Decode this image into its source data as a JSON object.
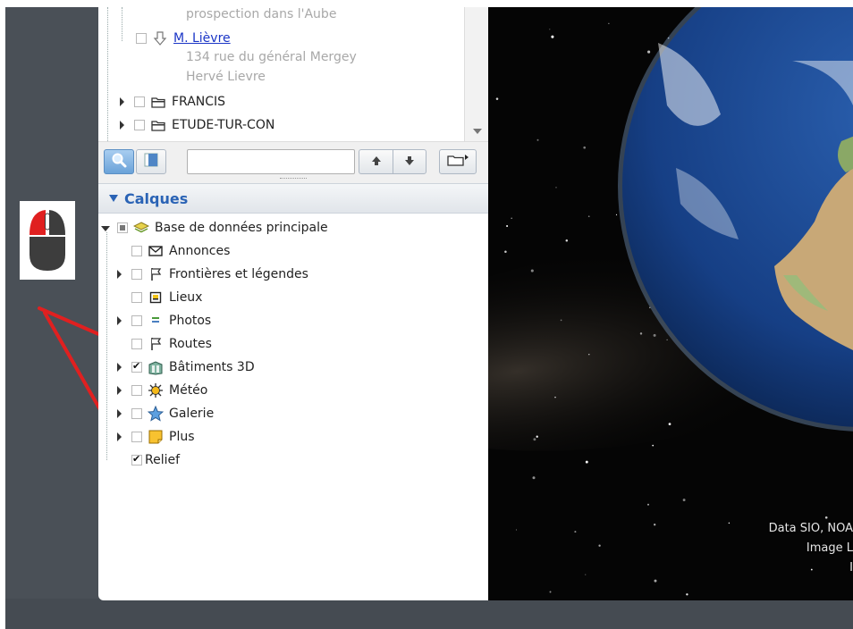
{
  "places": {
    "items": [
      {
        "text": "prospection dans l'Aube",
        "kind": "gray"
      },
      {
        "text": "M. Lièvre",
        "kind": "link"
      },
      {
        "text": "134 rue du général Mergey",
        "kind": "gray"
      },
      {
        "text": "Hervé Lievre",
        "kind": "gray"
      },
      {
        "text": "FRANCIS",
        "kind": "folder"
      },
      {
        "text": "ETUDE-TUR-CON",
        "kind": "folder"
      }
    ]
  },
  "toolbar": {
    "search_value": "",
    "up_icon": "arrow-up-icon",
    "down_icon": "arrow-down-icon",
    "add_folder_icon": "folder-add-icon"
  },
  "layers": {
    "header": "Calques",
    "root": "Base de données principale",
    "items": [
      {
        "label": "Annonces",
        "checked": false,
        "expandable": false,
        "icon": "envelope-icon"
      },
      {
        "label": "Frontières et légendes",
        "checked": false,
        "expandable": true,
        "icon": "flag-icon"
      },
      {
        "label": "Lieux",
        "checked": false,
        "expandable": false,
        "icon": "place-icon"
      },
      {
        "label": "Photos",
        "checked": false,
        "expandable": true,
        "icon": "photo-icon"
      },
      {
        "label": "Routes",
        "checked": false,
        "expandable": false,
        "icon": "flag-icon"
      },
      {
        "label": "Bâtiments 3D",
        "checked": true,
        "expandable": true,
        "icon": "building-3d-icon"
      },
      {
        "label": "Météo",
        "checked": false,
        "expandable": true,
        "icon": "sun-icon"
      },
      {
        "label": "Galerie",
        "checked": false,
        "expandable": true,
        "icon": "star-icon"
      },
      {
        "label": "Plus",
        "checked": false,
        "expandable": true,
        "icon": "note-icon"
      },
      {
        "label": "Relief",
        "checked": true,
        "expandable": false,
        "icon": ""
      }
    ]
  },
  "map": {
    "attribution": [
      "Data SIO, NOA",
      "Image L",
      "I"
    ]
  },
  "colors": {
    "accent": "#2a63b5",
    "annotation_arrow": "#e02020",
    "mouse_left_button": "#e02020"
  }
}
